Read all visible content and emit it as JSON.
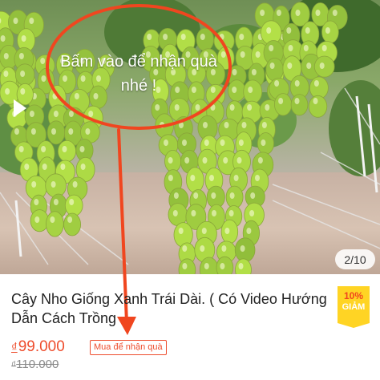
{
  "image": {
    "callout_text": "Bấm vào để nhận quà nhé !",
    "page_counter": "2/10",
    "play_icon": "play-icon"
  },
  "product": {
    "title": "Cây Nho Giống Xanh Trái Dài. ( Có Video Hướng Dẫn Cách Trồng",
    "discount_percent": "10%",
    "discount_label": "GIẢM",
    "currency_symbol": "₫",
    "price": "99.000",
    "gift_tag": "Mua để nhận quà",
    "old_price": "110.000"
  },
  "colors": {
    "accent": "#ee4d2d",
    "callout": "#f0461f",
    "badge": "#ffd424"
  }
}
